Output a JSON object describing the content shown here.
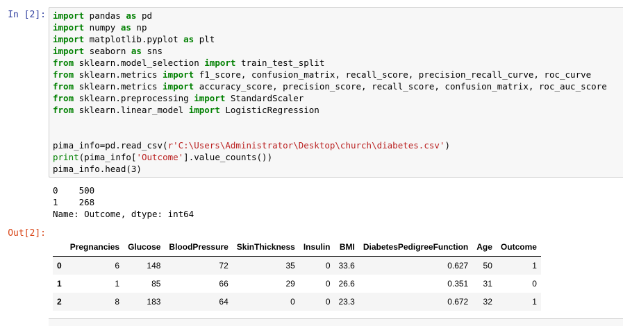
{
  "in_prompt": "In [2]:",
  "out_prompt": "Out[2]:",
  "code_lines": [
    [
      {
        "t": "import",
        "c": "kw"
      },
      {
        "t": " pandas "
      },
      {
        "t": "as",
        "c": "kw"
      },
      {
        "t": " pd"
      }
    ],
    [
      {
        "t": "import",
        "c": "kw"
      },
      {
        "t": " numpy "
      },
      {
        "t": "as",
        "c": "kw"
      },
      {
        "t": " np"
      }
    ],
    [
      {
        "t": "import",
        "c": "kw"
      },
      {
        "t": " matplotlib.pyplot "
      },
      {
        "t": "as",
        "c": "kw"
      },
      {
        "t": " plt"
      }
    ],
    [
      {
        "t": "import",
        "c": "kw"
      },
      {
        "t": " seaborn "
      },
      {
        "t": "as",
        "c": "kw"
      },
      {
        "t": " sns"
      }
    ],
    [
      {
        "t": "from",
        "c": "kw"
      },
      {
        "t": " sklearn.model_selection "
      },
      {
        "t": "import",
        "c": "kw"
      },
      {
        "t": " train_test_split"
      }
    ],
    [
      {
        "t": "from",
        "c": "kw"
      },
      {
        "t": " sklearn.metrics "
      },
      {
        "t": "import",
        "c": "kw"
      },
      {
        "t": " f1_score, confusion_matrix, recall_score, precision_recall_curve, roc_curve"
      }
    ],
    [
      {
        "t": "from",
        "c": "kw"
      },
      {
        "t": " sklearn.metrics "
      },
      {
        "t": "import",
        "c": "kw"
      },
      {
        "t": " accuracy_score, precision_score, recall_score, confusion_matrix, roc_auc_score"
      }
    ],
    [
      {
        "t": "from",
        "c": "kw"
      },
      {
        "t": " sklearn.preprocessing "
      },
      {
        "t": "import",
        "c": "kw"
      },
      {
        "t": " StandardScaler"
      }
    ],
    [
      {
        "t": "from",
        "c": "kw"
      },
      {
        "t": " sklearn.linear_model "
      },
      {
        "t": "import",
        "c": "kw"
      },
      {
        "t": " LogisticRegression"
      }
    ],
    [],
    [],
    [
      {
        "t": "pima_info=pd.read_csv("
      },
      {
        "t": "r'C:\\Users\\Administrator\\Desktop\\church\\diabetes.csv'",
        "c": "str"
      },
      {
        "t": ")"
      }
    ],
    [
      {
        "t": "print",
        "c": "bi"
      },
      {
        "t": "(pima_info["
      },
      {
        "t": "'Outcome'",
        "c": "str"
      },
      {
        "t": "].value_counts())"
      }
    ],
    [
      {
        "t": "pima_info.head(3)"
      }
    ]
  ],
  "stdout_lines": [
    "0    500",
    "1    268",
    "Name: Outcome, dtype: int64"
  ],
  "table": {
    "columns": [
      "",
      "Pregnancies",
      "Glucose",
      "BloodPressure",
      "SkinThickness",
      "Insulin",
      "BMI",
      "DiabetesPedigreeFunction",
      "Age",
      "Outcome"
    ],
    "rows": [
      [
        "0",
        "6",
        "148",
        "72",
        "35",
        "0",
        "33.6",
        "0.627",
        "50",
        "1"
      ],
      [
        "1",
        "1",
        "85",
        "66",
        "29",
        "0",
        "26.6",
        "0.351",
        "31",
        "0"
      ],
      [
        "2",
        "8",
        "183",
        "64",
        "0",
        "0",
        "23.3",
        "0.672",
        "32",
        "1"
      ]
    ]
  }
}
